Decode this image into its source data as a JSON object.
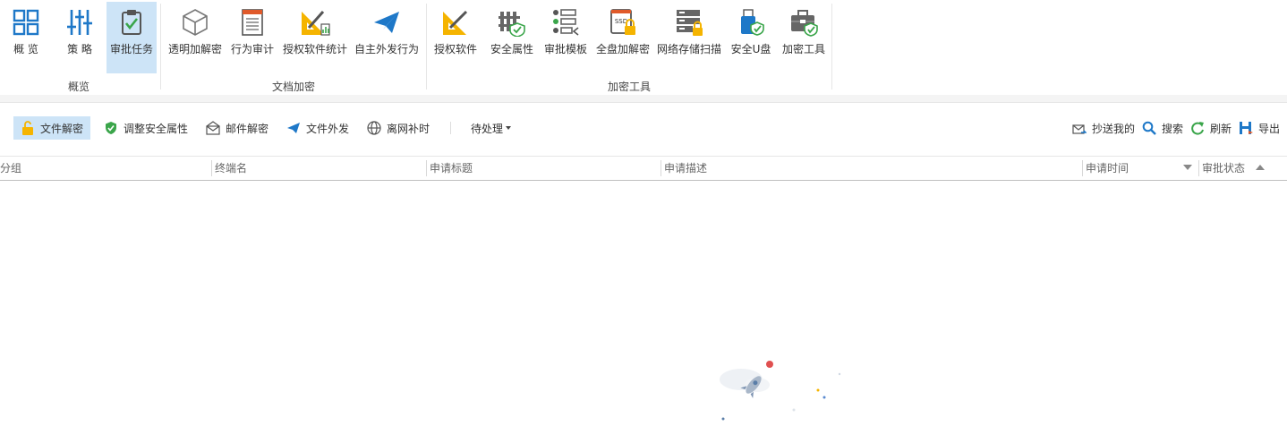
{
  "ribbon": {
    "groups": [
      {
        "label": "概览"
      },
      {
        "label": "文档加密"
      },
      {
        "label": "加密工具"
      }
    ],
    "buttons": [
      {
        "label": "概 览",
        "icon": "grid-icon"
      },
      {
        "label": "策 略",
        "icon": "sliders-icon"
      },
      {
        "label": "审批任务",
        "icon": "clipboard-check-icon"
      },
      {
        "label": "透明加解密",
        "icon": "cube-icon"
      },
      {
        "label": "行为审计",
        "icon": "log-sheet-icon"
      },
      {
        "label": "授权软件统计",
        "icon": "ruler-pencil-chart-icon"
      },
      {
        "label": "自主外发行为",
        "icon": "paper-plane-icon"
      },
      {
        "label": "授权软件",
        "icon": "ruler-pencil-icon"
      },
      {
        "label": "安全属性",
        "icon": "fence-shield-icon"
      },
      {
        "label": "审批模板",
        "icon": "template-list-icon"
      },
      {
        "label": "全盘加解密",
        "icon": "ssd-lock-icon"
      },
      {
        "label": "网络存储扫描",
        "icon": "server-lock-icon"
      },
      {
        "label": "安全U盘",
        "icon": "usb-shield-icon"
      },
      {
        "label": "加密工具",
        "icon": "toolbox-shield-icon"
      }
    ]
  },
  "toolbar": {
    "left": [
      {
        "label": "文件解密",
        "icon": "unlock-icon"
      },
      {
        "label": "调整安全属性",
        "icon": "shield-icon"
      },
      {
        "label": "邮件解密",
        "icon": "mail-icon"
      },
      {
        "label": "文件外发",
        "icon": "paper-plane-icon"
      },
      {
        "label": "离网补时",
        "icon": "globe-icon"
      }
    ],
    "filter": "待处理",
    "right": [
      {
        "label": "抄送我的",
        "icon": "mail-cc-icon"
      },
      {
        "label": "搜索",
        "icon": "search-icon"
      },
      {
        "label": "刷新",
        "icon": "refresh-icon"
      },
      {
        "label": "导出",
        "icon": "export-icon"
      }
    ]
  },
  "table": {
    "columns": [
      "分组",
      "终端名",
      "申请标题",
      "申请描述",
      "申请时间",
      "审批状态"
    ]
  },
  "colors": {
    "accent": "#1e78c8",
    "active_bg": "#cde4f7",
    "lock_yellow": "#f5b400",
    "shield_green": "#3aa54a"
  }
}
